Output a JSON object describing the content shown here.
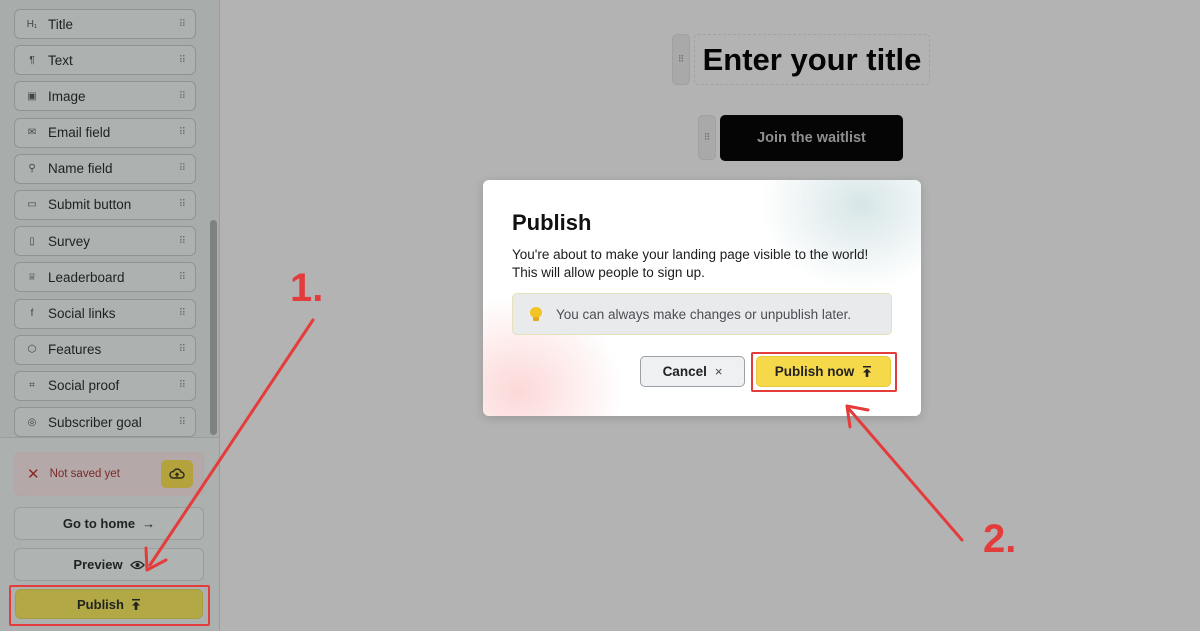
{
  "sidebar": {
    "blocks": [
      {
        "icon": "title-icon",
        "glyph": "H₁",
        "label": "Title"
      },
      {
        "icon": "paragraph-icon",
        "glyph": "¶",
        "label": "Text"
      },
      {
        "icon": "image-icon",
        "glyph": "▣",
        "label": "Image"
      },
      {
        "icon": "mail-icon",
        "glyph": "✉",
        "label": "Email field"
      },
      {
        "icon": "person-icon",
        "glyph": "⚲",
        "label": "Name field"
      },
      {
        "icon": "button-icon",
        "glyph": "▭",
        "label": "Submit button"
      },
      {
        "icon": "clipboard-icon",
        "glyph": "▯",
        "label": "Survey"
      },
      {
        "icon": "trophy-icon",
        "glyph": "♕",
        "label": "Leaderboard"
      },
      {
        "icon": "facebook-icon",
        "glyph": "f",
        "label": "Social links"
      },
      {
        "icon": "cube-icon",
        "glyph": "⬡",
        "label": "Features"
      },
      {
        "icon": "proof-icon",
        "glyph": "⌗",
        "label": "Social proof"
      },
      {
        "icon": "target-icon",
        "glyph": "◎",
        "label": "Subscriber goal"
      }
    ],
    "status_text": "Not saved yet",
    "go_home_label": "Go to home",
    "go_home_arrow": "→",
    "preview_label": "Preview",
    "publish_label": "Publish"
  },
  "canvas": {
    "title": "Enter your title",
    "cta_label": "Join the waitlist"
  },
  "modal": {
    "title": "Publish",
    "body": "You're about to make your landing page visible to the world! This will allow people to sign up.",
    "tip": "You can always make changes or unpublish later.",
    "cancel_label": "Cancel",
    "cancel_x": "×",
    "publish_now_label": "Publish now"
  },
  "annotations": {
    "step1": "1.",
    "step2": "2."
  },
  "colors": {
    "accent_red": "#e43b3b",
    "publish_yellow": "#f5d94b",
    "overlay_gray": "#b3b3b3"
  }
}
